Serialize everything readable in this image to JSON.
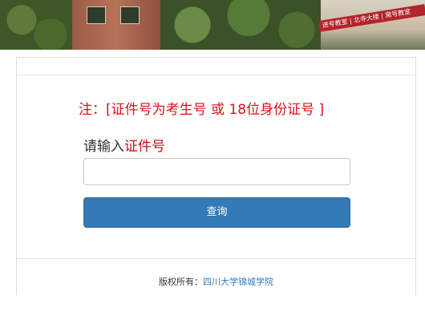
{
  "banner": {
    "sign_text": "进号教室 | 北寺大楼 | 窝号教室"
  },
  "form": {
    "notice": "注：[证件号为考生号 或 18位身份证号 ]",
    "prompt_prefix": "请输入",
    "prompt_highlight": "证件号",
    "input_value": "",
    "input_placeholder": "",
    "query_label": "查询"
  },
  "footer": {
    "copyright_label": "版权所有：",
    "org_name": "四川大学锦城学院"
  },
  "colors": {
    "notice_red": "#e0101e",
    "button_blue": "#337ab7",
    "link_blue": "#337ab7"
  }
}
